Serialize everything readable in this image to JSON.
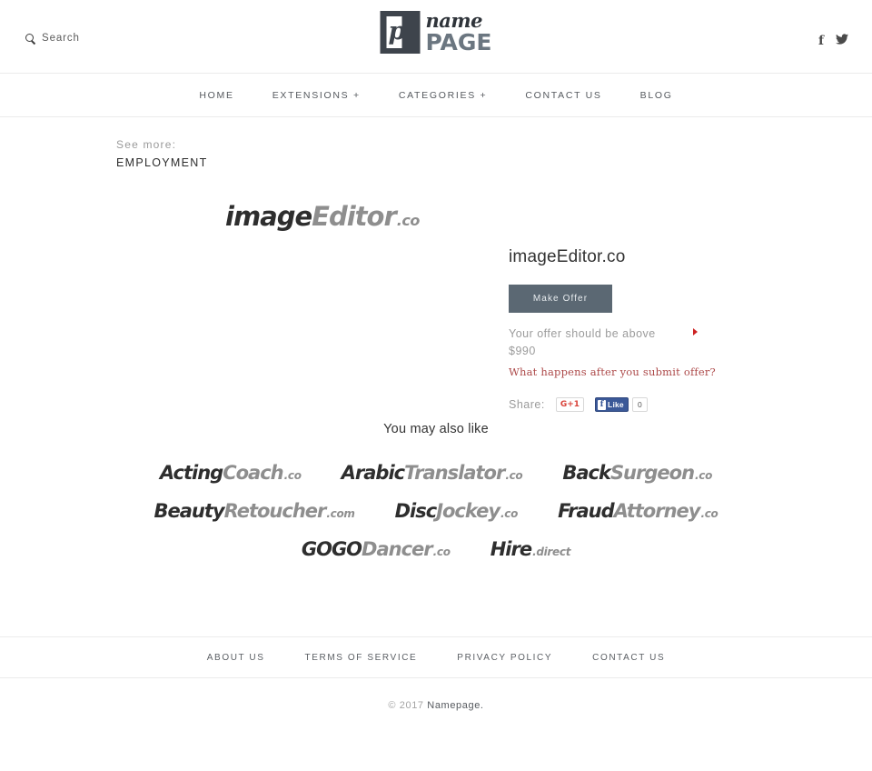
{
  "header": {
    "search": {
      "label": "Search",
      "icon": "search-icon"
    },
    "logo": {
      "mark_letter": "p",
      "name": "name",
      "page": "PAGE"
    },
    "social": [
      {
        "icon": "facebook-icon",
        "glyph": "f"
      },
      {
        "icon": "twitter-icon",
        "glyph": "twitter-bird"
      }
    ]
  },
  "nav": {
    "items": [
      {
        "label": "HOME"
      },
      {
        "label": "EXTENSIONS +"
      },
      {
        "label": "CATEGORIES +"
      },
      {
        "label": "CONTACT US"
      },
      {
        "label": "BLOG"
      }
    ]
  },
  "see_more": {
    "label": "See more:",
    "category": "EMPLOYMENT"
  },
  "domain_art": {
    "word1": "image",
    "word2": "Editor",
    "tld": ".co"
  },
  "offer": {
    "title": "imageEditor.co",
    "button_label": "Make Offer",
    "note": "Your offer should be above $990",
    "note_line1": "Your offer should be above",
    "note_line2": "$990",
    "price": "$990",
    "help_link": "What happens after you submit offer?",
    "arrow_icon": "red-triangle-right-icon",
    "share_label": "Share:",
    "google_plus_label": "G+1",
    "facebook_like_label": "Like",
    "facebook_like_count": "0",
    "colors": {
      "button_bg": "#5b6873",
      "link": "#ad4a4a",
      "arrow": "#cc2222",
      "facebook_blue": "#3b5998",
      "google_red": "#d9433a"
    }
  },
  "also_like": {
    "title": "You may also like",
    "rows": [
      [
        {
          "word1": "Acting",
          "word2": "Coach",
          "tld": ".co"
        },
        {
          "word1": "Arabic",
          "word2": "Translator",
          "tld": ".co"
        },
        {
          "word1": "Back",
          "word2": "Surgeon",
          "tld": ".co"
        }
      ],
      [
        {
          "word1": "Beauty",
          "word2": "Retoucher",
          "tld": ".com"
        },
        {
          "word1": "Disc",
          "word2": "Jockey",
          "tld": ".co"
        },
        {
          "word1": "Fraud",
          "word2": "Attorney",
          "tld": ".co"
        }
      ],
      [
        {
          "word1": "GOGO",
          "word2": "Dancer",
          "tld": ".co"
        },
        {
          "word1": "Hire",
          "word2": "",
          "tld": ".direct"
        }
      ]
    ]
  },
  "footer": {
    "links": [
      {
        "label": "ABOUT US"
      },
      {
        "label": "TERMS OF SERVICE"
      },
      {
        "label": "PRIVACY POLICY"
      },
      {
        "label": "CONTACT US"
      }
    ],
    "copyright_prefix": "© 2017 ",
    "copyright_brand": "Namepage."
  }
}
